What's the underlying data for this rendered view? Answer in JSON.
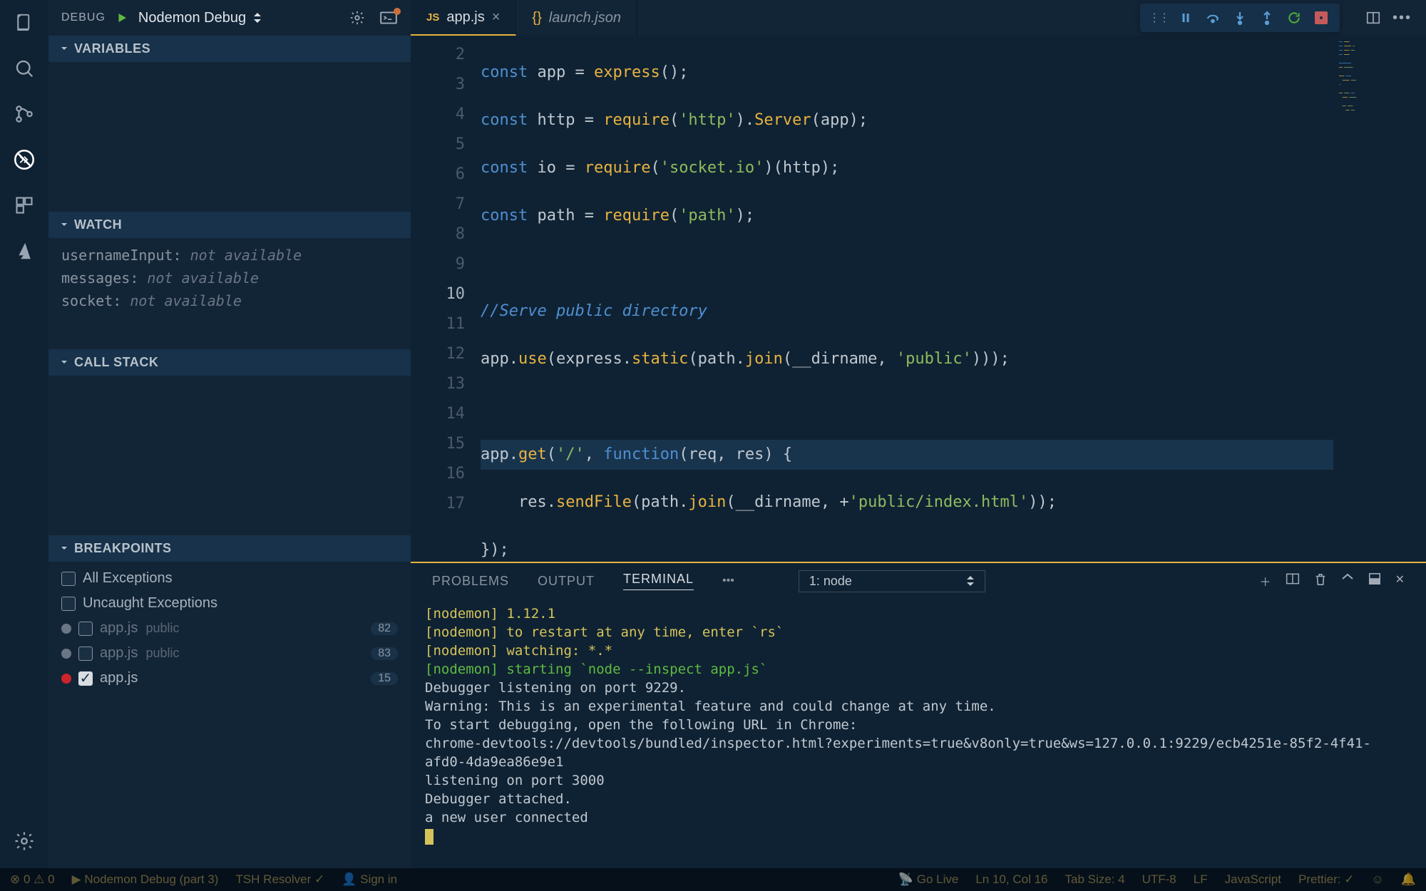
{
  "activitybar": {
    "items": [
      "files",
      "search",
      "source-control",
      "debug",
      "extensions",
      "azure"
    ]
  },
  "debug": {
    "label": "DEBUG",
    "config": "Nodemon Debug",
    "sections": {
      "variables": "VARIABLES",
      "watch": "WATCH",
      "callstack": "CALL STACK",
      "breakpoints": "BREAKPOINTS"
    },
    "watch": [
      {
        "name": "usernameInput:",
        "val": "not available"
      },
      {
        "name": "messages:",
        "val": "not available"
      },
      {
        "name": "socket:",
        "val": "not available"
      }
    ],
    "breakpoints_fixed": [
      {
        "label": "All Exceptions",
        "checked": false
      },
      {
        "label": "Uncaught Exceptions",
        "checked": false
      }
    ],
    "breakpoints": [
      {
        "file": "app.js",
        "folder": "public",
        "line": "82",
        "on": false,
        "checked": false
      },
      {
        "file": "app.js",
        "folder": "public",
        "line": "83",
        "on": false,
        "checked": false
      },
      {
        "file": "app.js",
        "folder": "",
        "line": "15",
        "on": true,
        "checked": true
      }
    ]
  },
  "tabs": [
    {
      "icon": "JS",
      "label": "app.js",
      "active": true
    },
    {
      "icon": "{}",
      "label": "launch.json",
      "active": false
    }
  ],
  "lineStart": 2,
  "highlightLine": 10,
  "bpLine": 15,
  "panel": {
    "tabs": [
      "PROBLEMS",
      "OUTPUT",
      "TERMINAL"
    ],
    "active": "TERMINAL",
    "termSelect": "1: node"
  },
  "terminal": {
    "head": "[nodemon]",
    "l1": " 1.12.1",
    "l2": " to restart at any time, enter `rs`",
    "l3": " watching: *.*",
    "l4": " starting `node --inspect app.js`",
    "l5": "Debugger listening on port 9229.",
    "l6": "Warning: This is an experimental feature and could change at any time.",
    "l7": "To start debugging, open the following URL in Chrome:",
    "l8": "    chrome-devtools://devtools/bundled/inspector.html?experiments=true&v8only=true&ws=127.0.0.1:9229/ecb4251e-85f2-4f41-afd0-4da9ea86e9e1",
    "l9": "listening on port 3000",
    "l10": "Debugger attached.",
    "l11": "a new user connected"
  },
  "status": {
    "errors": "0",
    "warnings": "0",
    "debug": "Nodemon Debug (part 3)",
    "resolver": "TSH Resolver ✓",
    "signin": "Sign in",
    "golive": "Go Live",
    "pos": "Ln 10, Col 16",
    "tabsize": "Tab Size: 4",
    "encoding": "UTF-8",
    "eol": "LF",
    "lang": "JavaScript",
    "prettier": "Prettier: ✓"
  }
}
